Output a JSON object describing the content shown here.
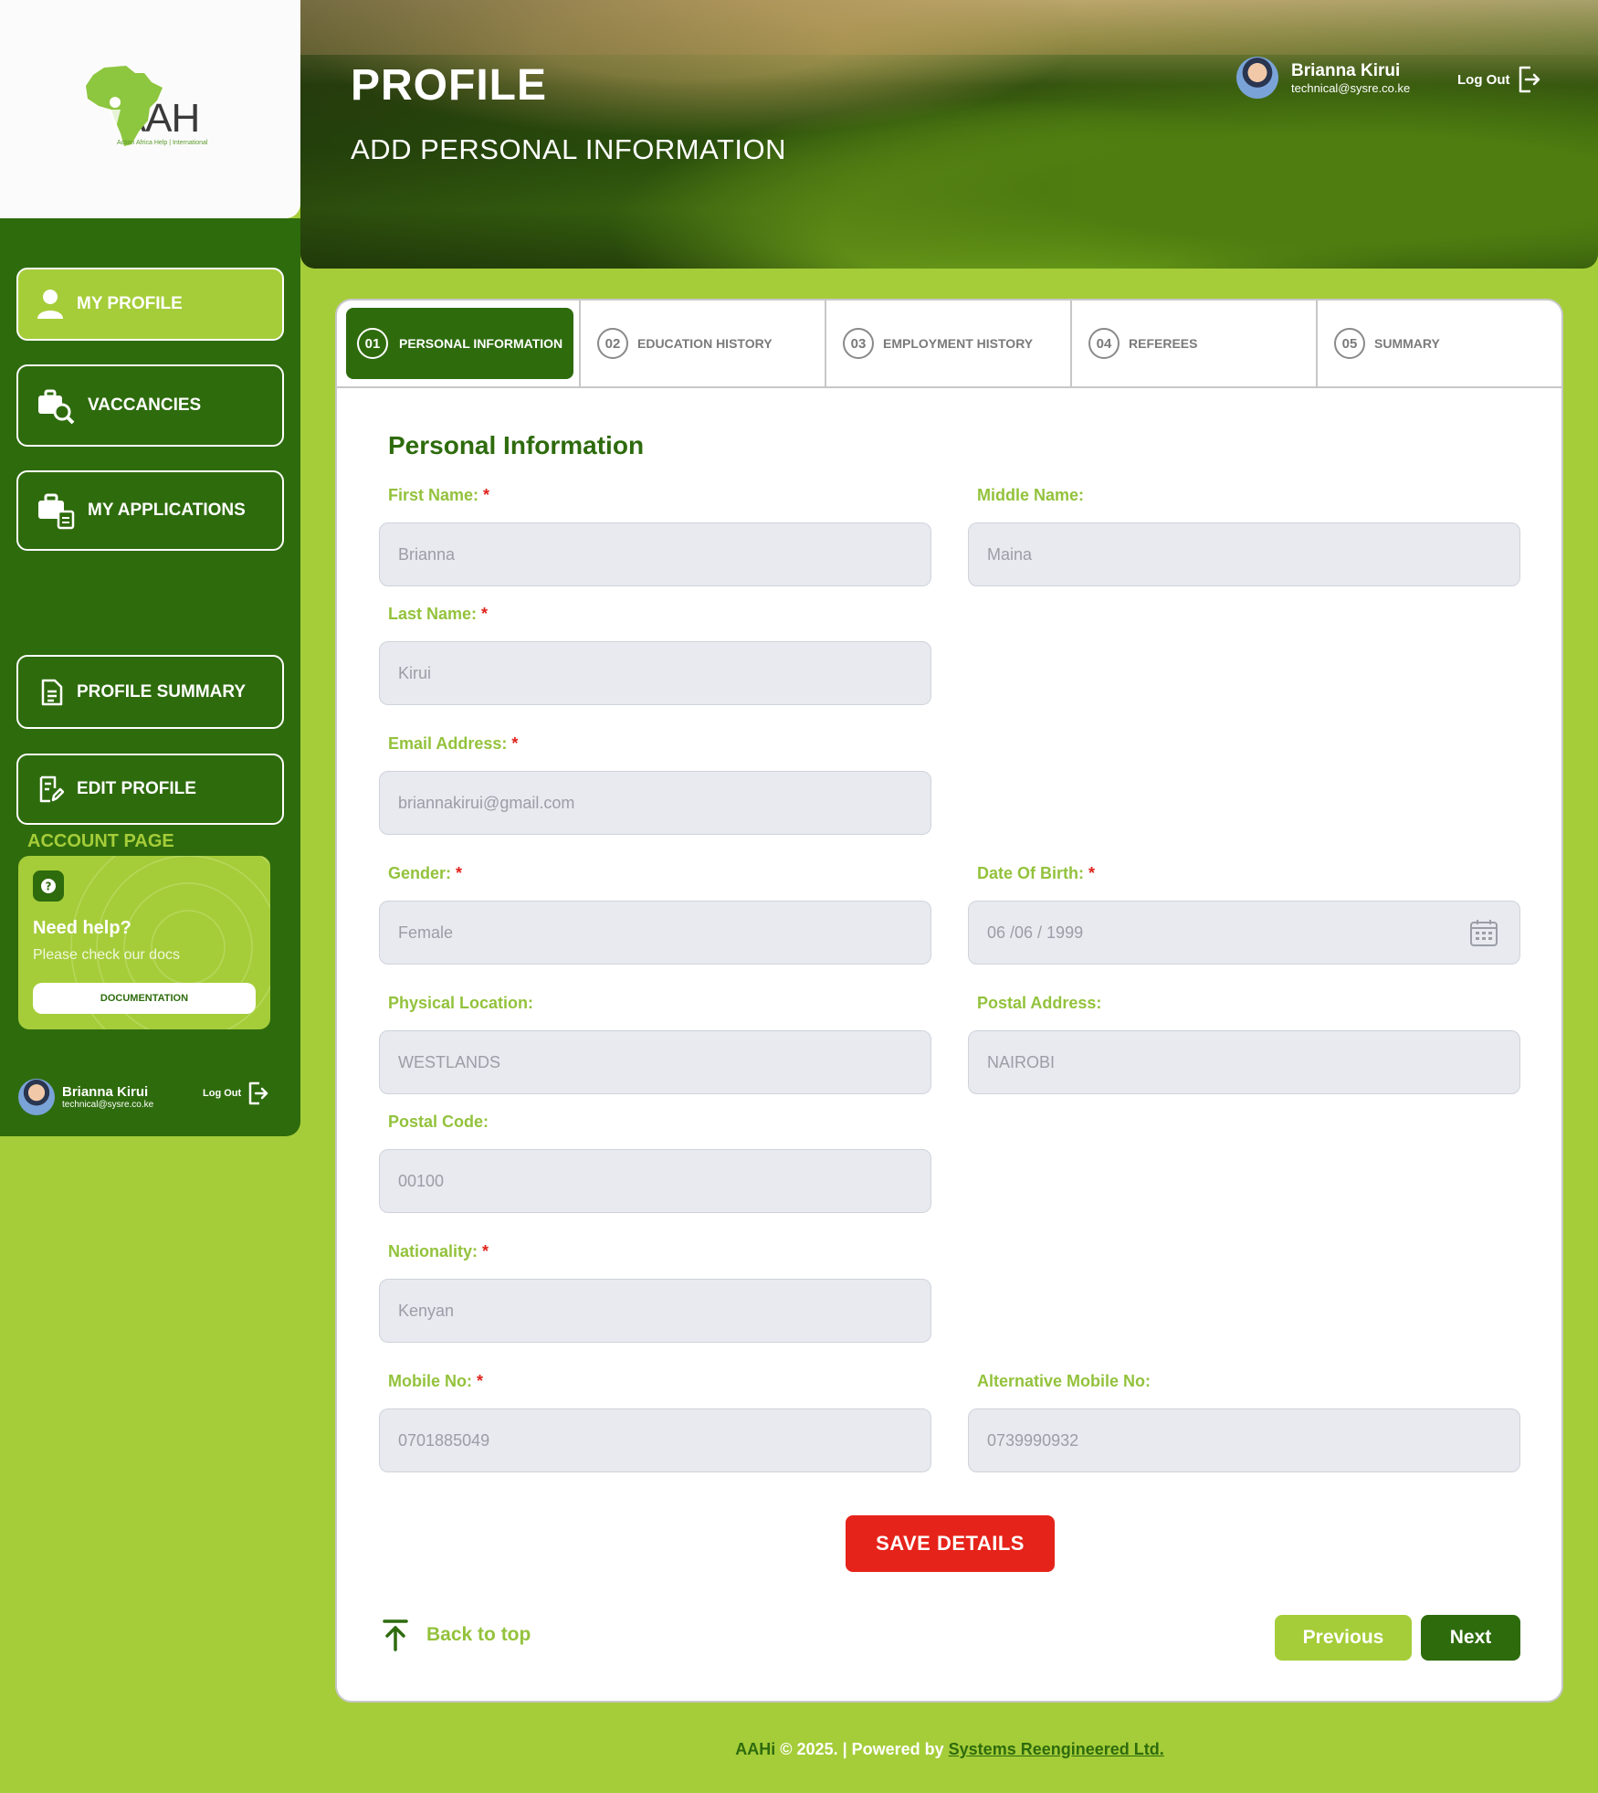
{
  "logo": {
    "text": "AAH",
    "tagline": "Action Africa Help | International"
  },
  "header": {
    "title": "PROFILE",
    "subtitle": "ADD PERSONAL INFORMATION",
    "user_name": "Brianna Kirui",
    "user_email": "technical@sysre.co.ke",
    "logout_label": "Log Out"
  },
  "sidebar": {
    "items": [
      {
        "label": "MY PROFILE",
        "icon": "user-icon",
        "active": true
      },
      {
        "label": "VACCANCIES",
        "icon": "briefcase-search-icon",
        "active": false
      },
      {
        "label": "MY APPLICATIONS",
        "icon": "briefcase-doc-icon",
        "active": false
      }
    ],
    "account_heading": "ACCOUNT PAGE",
    "account_items": [
      {
        "label": "PROFILE SUMMARY",
        "icon": "document-icon"
      },
      {
        "label": "EDIT PROFILE",
        "icon": "edit-document-icon"
      }
    ],
    "help": {
      "title": "Need help?",
      "subtitle": "Please check our docs",
      "button_label": "DOCUMENTATION"
    },
    "user_name": "Brianna Kirui",
    "user_email": "technical@sysre.co.ke",
    "logout_label": "Log Out"
  },
  "steps": [
    {
      "num": "01",
      "label": "PERSONAL INFORMATION",
      "active": true
    },
    {
      "num": "02",
      "label": "EDUCATION HISTORY",
      "active": false
    },
    {
      "num": "03",
      "label": "EMPLOYMENT HISTORY",
      "active": false
    },
    {
      "num": "04",
      "label": "REFEREES",
      "active": false
    },
    {
      "num": "05",
      "label": "SUMMARY",
      "active": false
    }
  ],
  "form": {
    "section_title": "Personal Information",
    "required_mark": "*",
    "first_name": {
      "label": "First Name:",
      "value": "Brianna"
    },
    "middle_name": {
      "label": "Middle Name:",
      "value": "Maina"
    },
    "last_name": {
      "label": "Last Name:",
      "value": "Kirui"
    },
    "email": {
      "label": "Email Address:",
      "value": "briannakirui@gmail.com"
    },
    "gender": {
      "label": "Gender:",
      "value": "Female"
    },
    "dob": {
      "label": "Date Of Birth:",
      "value": "06 /06 / 1999"
    },
    "physical_location": {
      "label": "Physical Location:",
      "value": "WESTLANDS"
    },
    "postal_address": {
      "label": "Postal Address:",
      "value": "NAIROBI"
    },
    "postal_code": {
      "label": "Postal Code:",
      "value": "00100"
    },
    "nationality": {
      "label": "Nationality:",
      "value": "Kenyan"
    },
    "mobile": {
      "label": "Mobile No:",
      "value": "0701885049"
    },
    "alt_mobile": {
      "label": "Alternative Mobile No:",
      "value": "0739990932"
    },
    "save_label": "SAVE DETAILS",
    "back_to_top": "Back to top",
    "previous_label": "Previous",
    "next_label": "Next"
  },
  "footer": {
    "brand": "AAHi",
    "text": " © 2025. | Powered by ",
    "link": "Systems Reengineered Ltd."
  },
  "colors": {
    "primary_dark": "#2e6b0d",
    "primary_light": "#a5cd39",
    "danger": "#e6231a",
    "field_bg": "#e8eaf0"
  }
}
